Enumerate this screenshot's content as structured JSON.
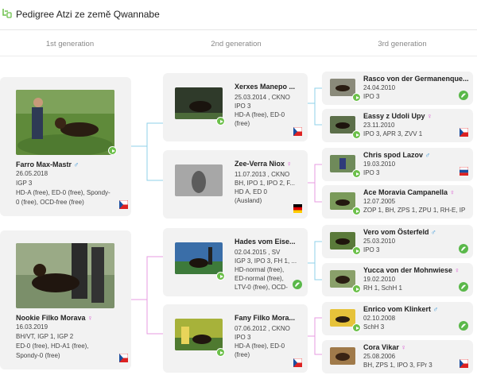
{
  "app": {
    "title": "Pedigree Atzi ze země Qwannabe"
  },
  "generations": [
    "1st generation",
    "2nd generation",
    "3rd generation"
  ],
  "gen1": [
    {
      "name": "Farro Max-Mastr",
      "sex": "♂",
      "date": "26.05.2018",
      "titles": "IGP 3",
      "health": "HD-A (free), ED-0 (free), Spondy-",
      "health2": "0 (free), OCD-free (free)"
    },
    {
      "name": "Nookie Filko Morava",
      "sex": "♀",
      "date": "16.03.2019",
      "titles": "BH/VT, IGP 1, IGP 2",
      "health": "ED-0 (free), HD-A1 (free),",
      "health2": "Spondy-0 (free)"
    }
  ],
  "gen2": [
    {
      "name": "Xerxes Manepo ...",
      "l1": "25.03.2014 , CKNO",
      "l2": "IPO 3",
      "l3": "HD-A (free), ED-0",
      "l4": "(free)"
    },
    {
      "name": "Zee-Verra Niox",
      "sex": "♀",
      "l1": "11.07.2013 , CKNO",
      "l2": "BH, IPO 1, IPO 2, F...",
      "l3": "HD A, ED 0",
      "l4": "(Ausland)"
    },
    {
      "name": "Hades vom Eise...",
      "l1": "02.04.2015 , SV",
      "l2": "IGP 3, IPO 3, FH 1, ...",
      "l3": "HD-normal (free),",
      "l4": "ED-normal (free),",
      "l5": "LTV-0 (free), OCD-"
    },
    {
      "name": "Fany Filko Mora...",
      "l1": "07.06.2012 , CKNO",
      "l2": "IPO 3",
      "l3": "HD-A (free), ED-0",
      "l4": "(free)"
    }
  ],
  "gen3": [
    {
      "name": "Rasco von der Germanenque...",
      "date": "24.04.2010",
      "titles": "IPO 3"
    },
    {
      "name": "Eassy z Udoli Upy",
      "sex": "♀",
      "date": "23.11.2010",
      "titles": "IPO 3, APR 3, ZVV 1"
    },
    {
      "name": "Chris spod Lazov",
      "sex": "♂",
      "date": "19.03.2010",
      "titles": "IPO 3"
    },
    {
      "name": "Ace Moravia Campanella",
      "sex": "♀",
      "date": "12.07.2005",
      "titles": "ZOP 1, BH, ZPS 1, ZPU 1, RH-E, IP"
    },
    {
      "name": "Vero vom Österfeld",
      "sex": "♂",
      "date": "25.03.2010",
      "titles": "IPO 3"
    },
    {
      "name": "Yucca von der Mohnwiese",
      "sex": "♀",
      "date": "19.02.2010",
      "titles": "RH 1, SchH 1"
    },
    {
      "name": "Enrico vom Klinkert",
      "sex": "♂",
      "date": "02.10.2008",
      "titles": "SchH 3"
    },
    {
      "name": "Cora Vikar",
      "sex": "♀",
      "date": "25.08.2006",
      "titles": "BH, ZPS 1, IPO 3, FPr 3"
    }
  ],
  "colors": {
    "accent": "#6cc04a",
    "male": "#2a8fd6",
    "female": "#d84fd0",
    "sire_line": "#8fd0e8",
    "dam_line": "#e79be0"
  }
}
